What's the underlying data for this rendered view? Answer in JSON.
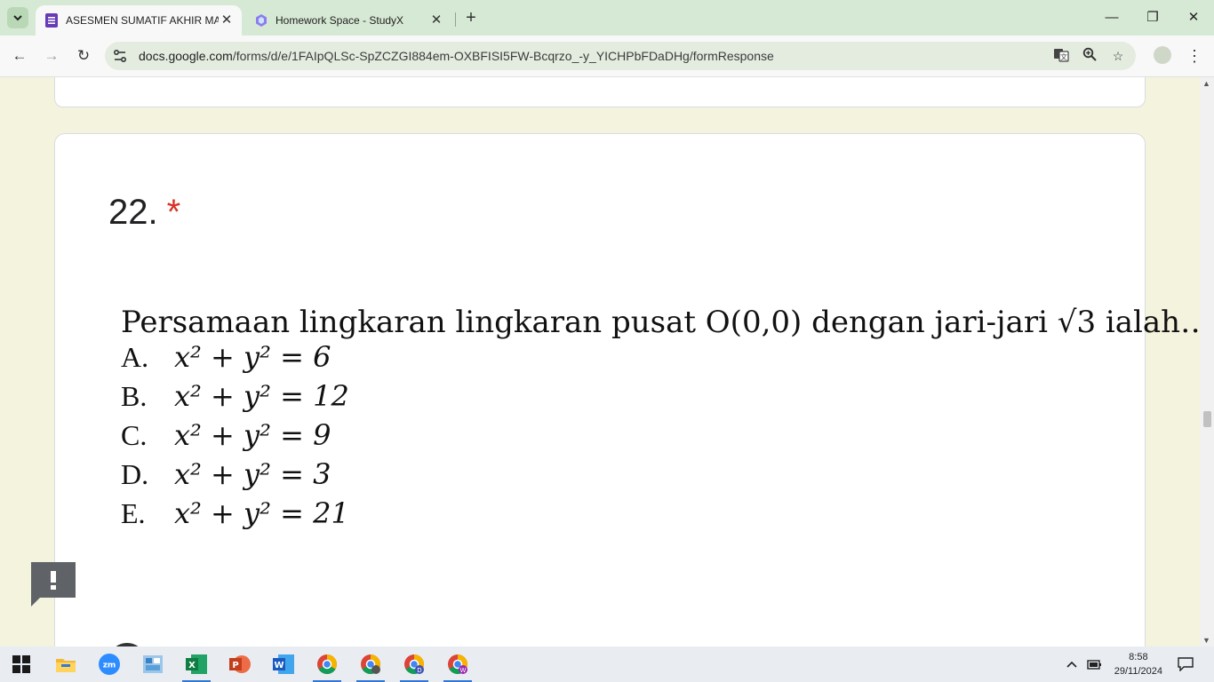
{
  "browser": {
    "tabs": [
      {
        "title": "ASESMEN SUMATIF AKHIR MAT",
        "active": true,
        "icon": "google-forms-icon"
      },
      {
        "title": "Homework Space - StudyX",
        "active": false,
        "icon": "studyx-icon"
      }
    ],
    "url_domain": "docs.google.com",
    "url_path": "/forms/d/e/1FAIpQLSc-SpZCZGI884em-OXBFISI5FW-Bcqrzo_-y_YICHPbFDaDHg/formResponse"
  },
  "question": {
    "number": "22.",
    "required_mark": "*",
    "text": "Persamaan lingkaran lingkaran pusat O(0,0) dengan jari-jari √3 ialah…",
    "options": [
      {
        "label": "A.",
        "equation": "x² + y² = 6"
      },
      {
        "label": "B.",
        "equation": "x² + y² = 12"
      },
      {
        "label": "C.",
        "equation": "x² + y² = 9"
      },
      {
        "label": "D.",
        "equation": "x² + y² = 3"
      },
      {
        "label": "E.",
        "equation": "x² + y² = 21"
      }
    ],
    "choice_first": "A"
  },
  "taskbar": {
    "time": "8:58",
    "date": "29/11/2024"
  },
  "colors": {
    "required": "#d93025",
    "page_bg": "#f4f3dd",
    "tabstrip_bg": "#d6e9d4"
  }
}
